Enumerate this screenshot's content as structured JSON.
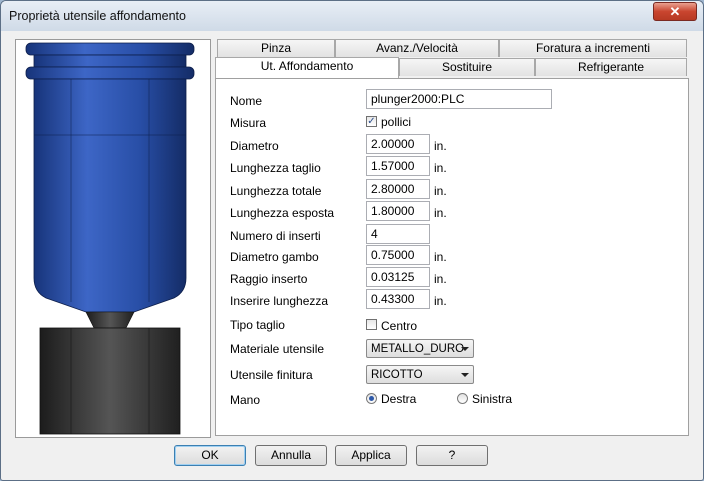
{
  "window": {
    "title": "Proprietà utensile affondamento",
    "close_label": "✕"
  },
  "tabs": {
    "row1": [
      "Pinza",
      "Avanz./Velocità",
      "Foratura a incrementi"
    ],
    "row2": [
      "Ut. Affondamento",
      "Sostituire",
      "Refrigerante"
    ],
    "active": "Ut. Affondamento"
  },
  "form": {
    "nome": {
      "label": "Nome",
      "value": "plunger2000:PLC"
    },
    "misura": {
      "label": "Misura",
      "checkbox_label": "pollici",
      "checked": true
    },
    "diametro": {
      "label": "Diametro",
      "value": "2.00000",
      "unit": "in."
    },
    "lunghezza_taglio": {
      "label": "Lunghezza taglio",
      "value": "1.57000",
      "unit": "in."
    },
    "lunghezza_totale": {
      "label": "Lunghezza totale",
      "value": "2.80000",
      "unit": "in."
    },
    "lunghezza_esposta": {
      "label": "Lunghezza esposta",
      "value": "1.80000",
      "unit": "in."
    },
    "numero_inserti": {
      "label": "Numero di inserti",
      "value": "4"
    },
    "diametro_gambo": {
      "label": "Diametro gambo",
      "value": "0.75000",
      "unit": "in."
    },
    "raggio_inserto": {
      "label": "Raggio inserto",
      "value": "0.03125",
      "unit": "in."
    },
    "inserire_lunghezza": {
      "label": "Inserire lunghezza",
      "value": "0.43300",
      "unit": "in."
    },
    "tipo_taglio": {
      "label": "Tipo taglio",
      "checkbox_label": "Centro",
      "checked": false
    },
    "materiale": {
      "label": "Materiale utensile",
      "selected": "METALLO_DURO"
    },
    "finitura": {
      "label": "Utensile finitura",
      "selected": "RICOTTO"
    },
    "mano": {
      "label": "Mano",
      "options": [
        "Destra",
        "Sinistra"
      ],
      "selected": "Destra"
    }
  },
  "buttons": {
    "ok": "OK",
    "annulla": "Annulla",
    "applica": "Applica",
    "help": "?"
  },
  "colors": {
    "tool_body": "#2a4fa8",
    "shank": "#3a3a3a",
    "close": "#c9452f"
  }
}
